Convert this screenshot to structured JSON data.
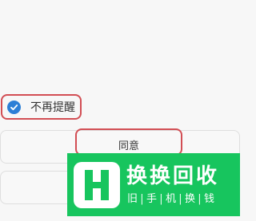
{
  "dialog": {
    "dont_remind_label": "不再提醒",
    "dont_remind_checked": true,
    "agree_button_label": "同意"
  },
  "watermark": {
    "brand_name": "换换回收",
    "slogan_chars": [
      "旧",
      "手",
      "机",
      "换",
      "钱"
    ],
    "logo_icon": "hh-logo-icon",
    "color": "#17c55e"
  },
  "colors": {
    "highlight": "#d24e54",
    "check": "#2d7fd6"
  }
}
